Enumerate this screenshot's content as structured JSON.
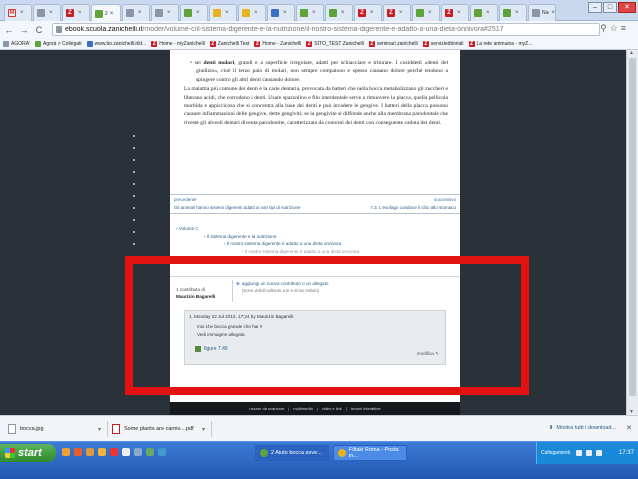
{
  "browser": {
    "tabs": [
      {
        "label": "",
        "fav": "gmail"
      },
      {
        "label": "",
        "fav": "gray"
      },
      {
        "label": "",
        "fav": "red"
      },
      {
        "label": "2",
        "fav": "green",
        "active": true
      },
      {
        "label": "",
        "fav": "gray"
      },
      {
        "label": "",
        "fav": "gray"
      },
      {
        "label": "",
        "fav": "green"
      },
      {
        "label": "",
        "fav": "yellow"
      },
      {
        "label": "",
        "fav": "yellow"
      },
      {
        "label": "",
        "fav": "blue"
      },
      {
        "label": "",
        "fav": "green"
      },
      {
        "label": "",
        "fav": "green"
      },
      {
        "label": "",
        "fav": "red"
      },
      {
        "label": "",
        "fav": "red"
      },
      {
        "label": "",
        "fav": "green"
      },
      {
        "label": "",
        "fav": "red"
      },
      {
        "label": "",
        "fav": "green"
      },
      {
        "label": "",
        "fav": "green"
      },
      {
        "label": "Nuo",
        "fav": "gray"
      }
    ],
    "url_host": "ebook.scuola.zanichelli.it",
    "url_path": "/moder/volume-c/il-sistema-digerente-e-la-nutrizione/il-nostro-sistema-digerente-e-adatto-a-una-dieta-onnivora#2517",
    "bookmarks": [
      "AGORA'",
      "Agorà > Collegati",
      "www.bo.zanichelli.it/d...",
      "Home - myZanichelli",
      "Zanichelli Test",
      "Home - Zanichelli",
      "SITO_TEST Zanichelli",
      "seminari zanichelli",
      "servizieditoriali",
      "La rete ammuina - myZ..."
    ]
  },
  "page": {
    "bullet_bold": "denti molari",
    "bullet_text_a": "sei ",
    "bullet_text_b": ", grandi e a superficie irregolare, adatti per schiacciare e triturare. I cosiddetti «denti del giudizio», cioè il terzo paio di molari, non sempre compaiono e spesso causano dolore perché tendono a spingere contro gli altri denti causando dolore.",
    "para1": "La malattia più comune dei denti è la carie dentaria, provocata da batteri che nella bocca metabolizzano gli zuccheri e liberano acidi, che corrodono i denti. Usare spazzolino e filo interdentale serve a rimuovere la placca, quella pellicola morbida e appiccicosa che si concentra alla base dei denti e può invadere le gengive. I batteri della placca possono causare infiammazioni delle gengive, dette gengiviti; se la gengivite si diffonde anche alla membrana parodontale che riveste gli alveoli dentari diventa parodontite, caratterizzata da contorni dei denti con conseguente caduta dei denti.",
    "prev_label": "precedente",
    "prev_link": "Gli animali hanno sistemi digerenti adatti ai vari tipi di nutrizione",
    "next_label": "successivo",
    "next_link": "7.3. L'esofago conduce il cibo allo stomaco",
    "tree": [
      "Volume C",
      "Il sistema digerente e la nutrizione",
      "Il nostro sistema digerente è adatto a una dieta onnivora",
      "Il nostro sistema digerente è adatto a una dieta onnivora"
    ],
    "comment_count": "1 contributo di",
    "comment_author": "Maurizio Bagarelli",
    "add_contribution": "aggiungi un nuovo contributo o un allegato",
    "add_contribution_sub": "(Sono visibili soltanto a te e al tuo istituto)",
    "comment_meta": "1. Monday 22 Jul 2013, 17:24 by Maurizio Bagarelli",
    "comment_line1": "mio che bocca grande che hai !!",
    "comment_line2": "Vedi immagine allegata",
    "attachment": "figure 7.45",
    "edit_label": "modifica",
    "footer_links": [
      "risorse da scaricare",
      "multimedia",
      "video e link",
      "lezioni interattive"
    ]
  },
  "downloads": {
    "item1": "bocca.jpg",
    "item2": "Some plants are carniv....pdf",
    "show_all": "Mostra tutti i download..."
  },
  "taskbar": {
    "start": "start",
    "tasks": [
      "2 Aiuto bocca avve...",
      "Filtaki Roma - Posta in..."
    ],
    "tray_label": "Collegamenti",
    "clock": "17:37"
  },
  "colors": {
    "highlight": "#e21212",
    "link": "#2a5a8a"
  }
}
